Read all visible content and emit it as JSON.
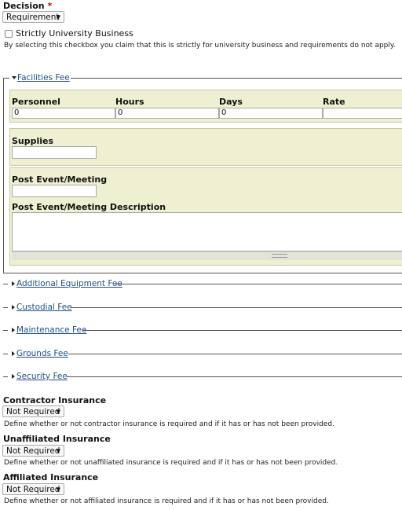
{
  "decision": {
    "label": "Decision",
    "required_marker": "*",
    "selected": "Requirement"
  },
  "strictly_university": {
    "label": "Strictly University Business",
    "checked": false,
    "help": "By selecting this checkbox you claim that this is strictly for university business and requirements do not apply."
  },
  "facilities_fee": {
    "legend": "Facilities Fee",
    "expanded": true,
    "columns": [
      "Personnel",
      "Hours",
      "Days",
      "Rate"
    ],
    "values": [
      "0",
      "0",
      "0",
      ""
    ],
    "supplies_label": "Supplies",
    "supplies_value": "",
    "post_event_label": "Post Event/Meeting",
    "post_event_value": "",
    "post_event_desc_label": "Post Event/Meeting Description",
    "post_event_desc_value": ""
  },
  "collapsed_sections": [
    "Additional Equipment Fee",
    "Custodial Fee",
    "Maintenance Fee",
    "Grounds Fee",
    "Security Fee"
  ],
  "contractor_insurance": {
    "label": "Contractor Insurance",
    "selected": "Not Required",
    "help": "Define whether or not contractor insurance is required and if it has or has not been provided."
  },
  "unaffiliated_insurance": {
    "label": "Unaffiliated Insurance",
    "selected": "Not Required",
    "help": "Define whether or not unaffiliated insurance is required and if it has or has not been provided."
  },
  "affiliated_insurance": {
    "label": "Affiliated Insurance",
    "selected": "Not Required",
    "help": "Define whether or not affiliated insurance is required and if it has or has not been provided."
  },
  "colors": {
    "panel_bg": "#efefd1",
    "link": "#1f4f88",
    "required": "#cc0000"
  }
}
